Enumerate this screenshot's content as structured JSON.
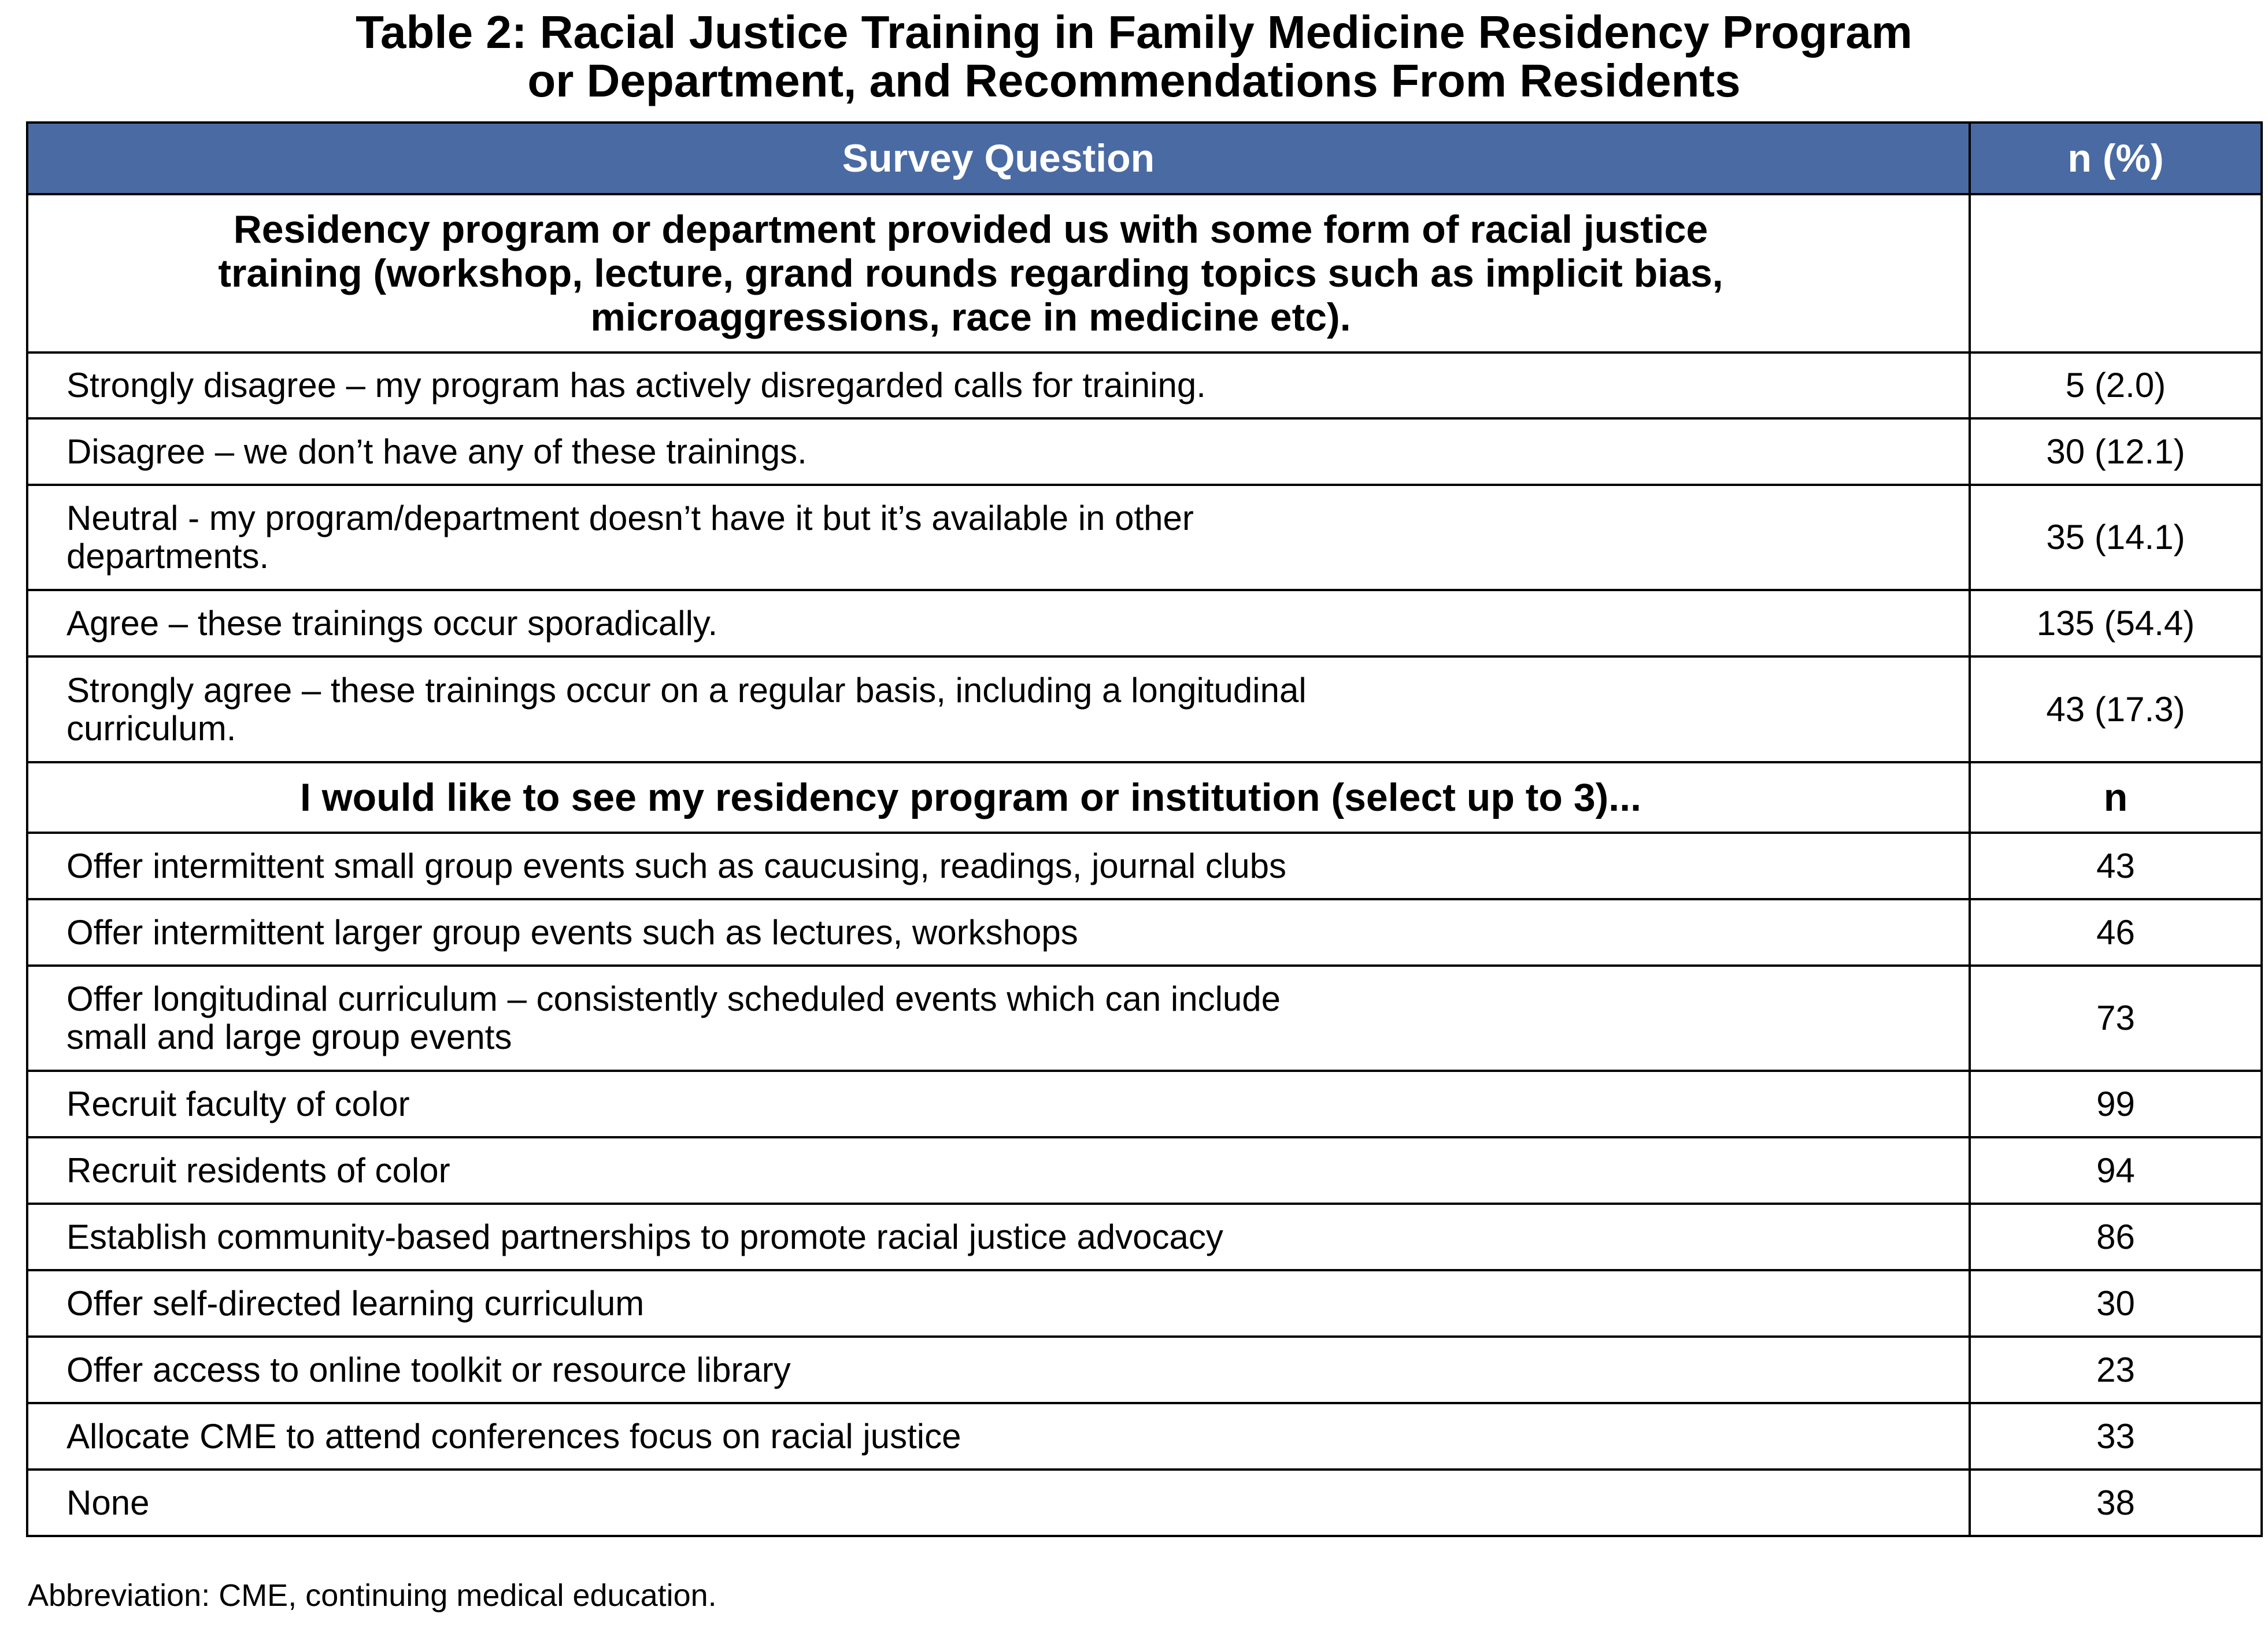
{
  "title": {
    "line1": "Table 2: Racial Justice Training in Family Medicine Residency Program",
    "line2": "or Department, and Recommendations From Residents"
  },
  "header": {
    "question": "Survey Question",
    "value": "n (%)"
  },
  "section1": {
    "question": "Residency program or department provided us with some form of racial justice training (workshop, lecture, grand rounds regarding topics such as implicit bias, microaggressions, race in medicine etc).",
    "value": "",
    "rows": [
      {
        "label": "Strongly disagree – my program has actively disregarded calls for training.",
        "value": "5 (2.0)"
      },
      {
        "label": "Disagree – we don’t have any of these trainings.",
        "value": "30 (12.1)"
      },
      {
        "label": "Neutral - my program/department doesn’t have it but it’s available in other departments.",
        "value": "35 (14.1)"
      },
      {
        "label": "Agree – these trainings occur sporadically.",
        "value": "135 (54.4)"
      },
      {
        "label": "Strongly agree – these trainings occur on a regular basis, including a longitudinal curriculum.",
        "value": "43 (17.3)"
      }
    ]
  },
  "section2": {
    "question": "I would like to see my residency program or institution (select up to 3)...",
    "value": "n",
    "rows": [
      {
        "label": "Offer intermittent small group events such as caucusing, readings, journal clubs",
        "value": "43"
      },
      {
        "label": "Offer intermittent larger group events such as lectures, workshops",
        "value": "46"
      },
      {
        "label": "Offer longitudinal curriculum – consistently scheduled events which can include small and large group events",
        "value": "73"
      },
      {
        "label": "Recruit faculty of color",
        "value": "99"
      },
      {
        "label": "Recruit residents of color",
        "value": "94"
      },
      {
        "label": "Establish community-based partnerships to promote racial justice advocacy",
        "value": "86"
      },
      {
        "label": "Offer self-directed learning curriculum",
        "value": "30"
      },
      {
        "label": "Offer access to online toolkit or resource library",
        "value": "23"
      },
      {
        "label": "Allocate CME to attend conferences focus on racial justice",
        "value": "33"
      },
      {
        "label": "None",
        "value": "38"
      }
    ]
  },
  "footnote": "Abbreviation: CME, continuing medical education.",
  "colors": {
    "header_bg": "#4a6aa3",
    "header_text": "#ffffff",
    "border": "#000000"
  }
}
